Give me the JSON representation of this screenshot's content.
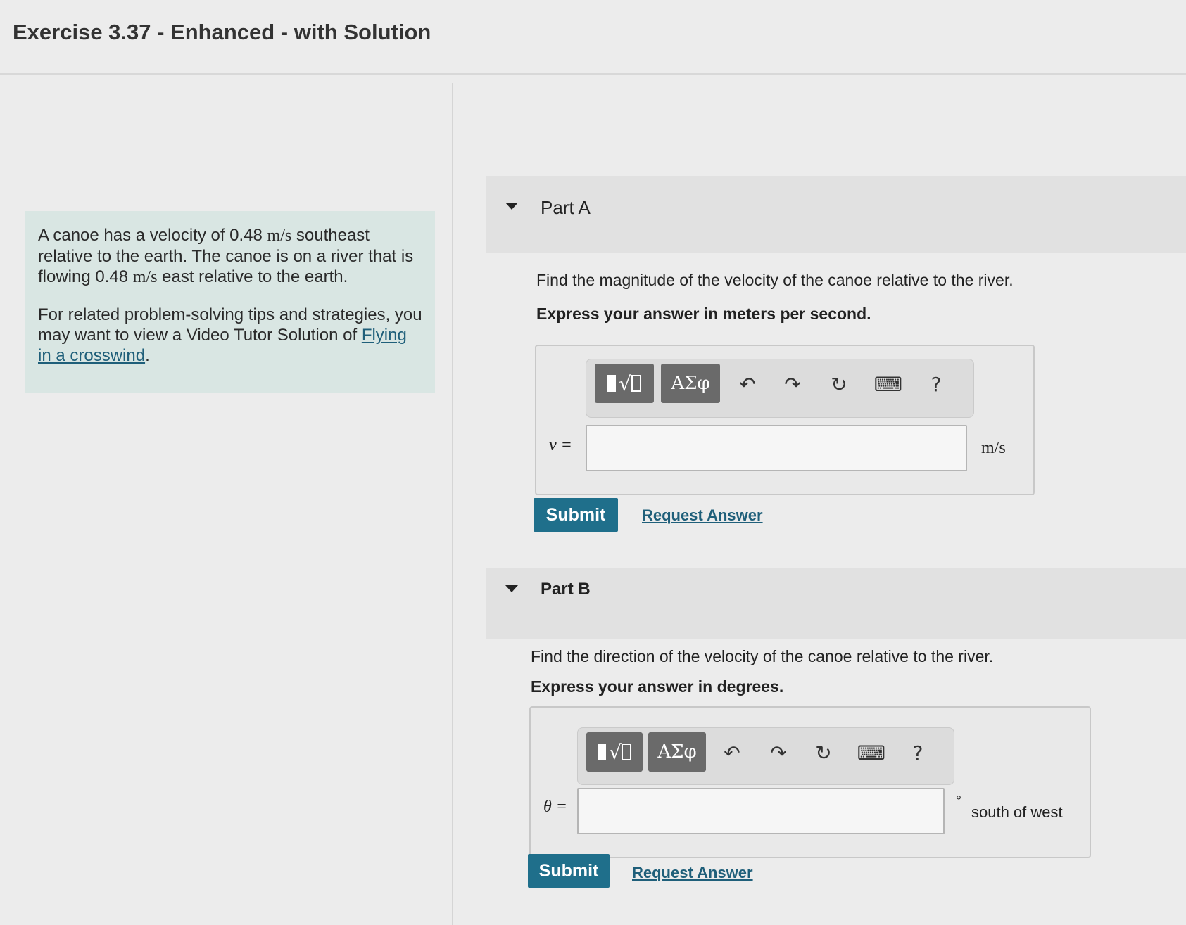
{
  "page": {
    "title": "Exercise 3.37 - Enhanced - with Solution"
  },
  "problem": {
    "para1_a": "A canoe has a velocity of 0.48 ",
    "para1_unit1": "m/s",
    "para1_b": " southeast relative to the earth. The canoe is on a river that is flowing 0.48 ",
    "para1_unit2": "m/s",
    "para1_c": " east relative to the earth.",
    "para2": "For related problem-solving tips and strategies, you may want to view a Video Tutor Solution of ",
    "link": "Flying in a crosswind",
    "link_suffix": "."
  },
  "toolbar": {
    "templates_label": "√",
    "greek_label": "ΑΣφ",
    "undo_icon": "undo-icon",
    "redo_icon": "redo-icon",
    "reset_icon": "reset-icon",
    "keyboard_icon": "keyboard-icon",
    "help_label": "?"
  },
  "partA": {
    "label": "Part A",
    "question": "Find the magnitude of the velocity of the canoe relative to the river.",
    "instruction": "Express your answer in meters per second.",
    "var_label": "v =",
    "input_value": "",
    "unit": "m/s",
    "submit": "Submit",
    "request": "Request Answer"
  },
  "partB": {
    "label": "Part B",
    "question": "Find the direction of the velocity of the canoe relative to the river.",
    "instruction": "Express your answer in degrees.",
    "var_label": "θ =",
    "input_value": "",
    "unit_symbol": "°",
    "unit": "south of west",
    "submit": "Submit",
    "request": "Request Answer"
  }
}
